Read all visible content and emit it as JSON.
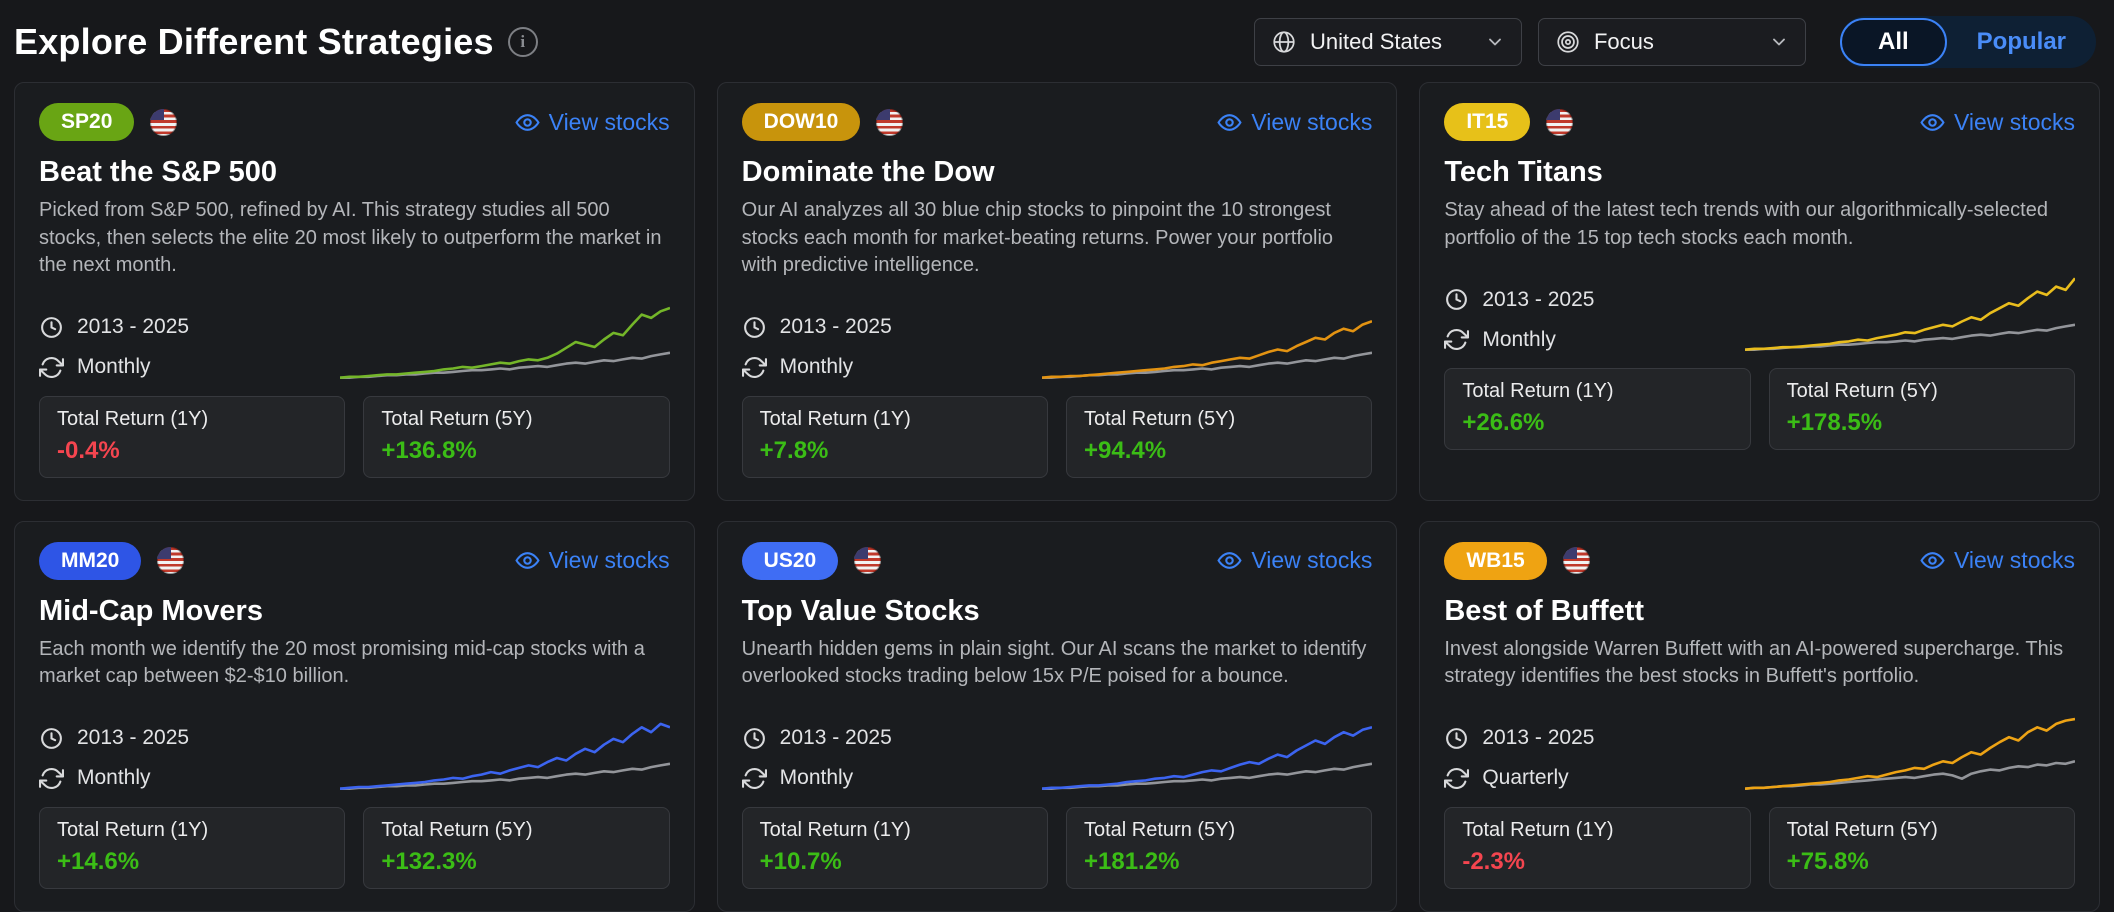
{
  "header": {
    "title": "Explore Different Strategies",
    "info_icon": "info-circle",
    "country_select": {
      "icon": "globe",
      "value": "United States"
    },
    "focus_select": {
      "icon": "target",
      "value": "Focus"
    },
    "filter_toggle": {
      "options": [
        "All",
        "Popular"
      ],
      "selected": "All"
    }
  },
  "colors": {
    "accent_blue": "#3b82f6",
    "positive_green": "#3bbd16",
    "negative_red": "#f4454f",
    "benchmark_gray": "#93959a"
  },
  "cards": [
    {
      "badge": "SP20",
      "badge_color": "#69a514",
      "flag": "united-states",
      "view_link": "View stocks",
      "title": "Beat the S&P 500",
      "description": "Picked from S&P 500, refined by AI. This strategy studies all 500 stocks, then selects the elite 20 most likely to outperform the market in the next month.",
      "period": "2013 - 2025",
      "frequency": "Monthly",
      "stats": [
        {
          "label": "Total Return (1Y)",
          "value": "-0.4%",
          "color": "#f4454f"
        },
        {
          "label": "Total Return (5Y)",
          "value": "+136.8%",
          "color": "#3bbd16"
        }
      ],
      "chart": {
        "type": "line",
        "line_color": "#74b629",
        "benchmark_color": "#93959a",
        "strategy": [
          4,
          5,
          5,
          6,
          7,
          8,
          8,
          9,
          10,
          11,
          12,
          14,
          15,
          17,
          16,
          18,
          20,
          22,
          21,
          24,
          26,
          25,
          28,
          33,
          40,
          47,
          44,
          41,
          50,
          58,
          55,
          68,
          80,
          76,
          84,
          88
        ],
        "benchmark": [
          4,
          4,
          5,
          5,
          6,
          7,
          7,
          8,
          8,
          9,
          10,
          10,
          11,
          12,
          13,
          13,
          14,
          15,
          14,
          16,
          17,
          18,
          17,
          19,
          21,
          22,
          21,
          23,
          25,
          24,
          26,
          28,
          27,
          30,
          32,
          34
        ]
      }
    },
    {
      "badge": "DOW10",
      "badge_color": "#c8940c",
      "flag": "united-states",
      "view_link": "View stocks",
      "title": "Dominate the Dow",
      "description": "Our AI analyzes all 30 blue chip stocks to pinpoint the 10 strongest stocks each month for market-beating returns. Power your portfolio with predictive intelligence.",
      "period": "2013 - 2025",
      "frequency": "Monthly",
      "stats": [
        {
          "label": "Total Return (1Y)",
          "value": "+7.8%",
          "color": "#3bbd16"
        },
        {
          "label": "Total Return (5Y)",
          "value": "+94.4%",
          "color": "#3bbd16"
        }
      ],
      "chart": {
        "type": "line",
        "line_color": "#e39312",
        "benchmark_color": "#93959a",
        "strategy": [
          4,
          5,
          5,
          6,
          6,
          7,
          8,
          9,
          10,
          11,
          12,
          13,
          14,
          15,
          17,
          18,
          20,
          19,
          22,
          24,
          26,
          28,
          27,
          31,
          35,
          38,
          36,
          42,
          47,
          52,
          50,
          58,
          63,
          60,
          68,
          72
        ],
        "benchmark": [
          4,
          4,
          5,
          5,
          6,
          7,
          7,
          8,
          8,
          9,
          10,
          10,
          11,
          12,
          13,
          13,
          14,
          15,
          14,
          16,
          17,
          18,
          17,
          19,
          21,
          22,
          21,
          23,
          25,
          24,
          26,
          28,
          27,
          30,
          32,
          34
        ]
      }
    },
    {
      "badge": "IT15",
      "badge_color": "#e7c119",
      "flag": "united-states",
      "view_link": "View stocks",
      "title": "Tech Titans",
      "description": "Stay ahead of the latest tech trends with our algorithmically-selected portfolio of the 15 top tech stocks each month.",
      "period": "2013 - 2025",
      "frequency": "Monthly",
      "stats": [
        {
          "label": "Total Return (1Y)",
          "value": "+26.6%",
          "color": "#3bbd16"
        },
        {
          "label": "Total Return (5Y)",
          "value": "+178.5%",
          "color": "#3bbd16"
        }
      ],
      "chart": {
        "type": "line",
        "line_color": "#e9bd1d",
        "benchmark_color": "#93959a",
        "strategy": [
          4,
          5,
          5,
          6,
          7,
          7,
          8,
          9,
          10,
          11,
          13,
          14,
          16,
          15,
          18,
          20,
          22,
          25,
          24,
          28,
          31,
          34,
          32,
          38,
          43,
          40,
          48,
          54,
          60,
          57,
          66,
          74,
          70,
          80,
          76,
          90
        ],
        "benchmark": [
          4,
          4,
          5,
          5,
          6,
          7,
          7,
          8,
          8,
          9,
          10,
          10,
          11,
          12,
          13,
          13,
          14,
          15,
          14,
          16,
          17,
          18,
          17,
          19,
          21,
          22,
          21,
          23,
          25,
          24,
          26,
          28,
          27,
          30,
          32,
          34
        ]
      }
    },
    {
      "badge": "MM20",
      "badge_color": "#2e55e6",
      "flag": "united-states",
      "view_link": "View stocks",
      "title": "Mid-Cap Movers",
      "description": "Each month we identify the 20 most promising mid-cap stocks with a market cap between $2-$10 billion.",
      "period": "2013 - 2025",
      "frequency": "Monthly",
      "stats": [
        {
          "label": "Total Return (1Y)",
          "value": "+14.6%",
          "color": "#3bbd16"
        },
        {
          "label": "Total Return (5Y)",
          "value": "+132.3%",
          "color": "#3bbd16"
        }
      ],
      "chart": {
        "type": "line",
        "line_color": "#3c64f0",
        "benchmark_color": "#93959a",
        "strategy": [
          4,
          5,
          6,
          6,
          7,
          8,
          9,
          10,
          11,
          12,
          14,
          15,
          17,
          16,
          19,
          21,
          24,
          22,
          26,
          29,
          32,
          30,
          36,
          41,
          38,
          46,
          52,
          48,
          57,
          64,
          60,
          70,
          78,
          72,
          82,
          78
        ],
        "benchmark": [
          4,
          4,
          5,
          5,
          6,
          7,
          7,
          8,
          8,
          9,
          10,
          10,
          11,
          12,
          13,
          13,
          14,
          15,
          14,
          16,
          17,
          18,
          17,
          19,
          21,
          22,
          21,
          23,
          25,
          24,
          26,
          28,
          27,
          30,
          32,
          34
        ]
      }
    },
    {
      "badge": "US20",
      "badge_color": "#3f6df4",
      "flag": "united-states",
      "view_link": "View stocks",
      "title": "Top Value Stocks",
      "description": "Unearth hidden gems in plain sight. Our AI scans the market to identify overlooked stocks trading below 15x P/E poised for a bounce.",
      "period": "2013 - 2025",
      "frequency": "Monthly",
      "stats": [
        {
          "label": "Total Return (1Y)",
          "value": "+10.7%",
          "color": "#3bbd16"
        },
        {
          "label": "Total Return (5Y)",
          "value": "+181.2%",
          "color": "#3bbd16"
        }
      ],
      "chart": {
        "type": "line",
        "line_color": "#3c64f0",
        "benchmark_color": "#93959a",
        "strategy": [
          4,
          5,
          5,
          6,
          7,
          8,
          8,
          9,
          10,
          12,
          13,
          14,
          16,
          17,
          19,
          18,
          21,
          24,
          26,
          25,
          29,
          33,
          36,
          34,
          40,
          45,
          42,
          50,
          56,
          62,
          58,
          66,
          72,
          68,
          75,
          78
        ],
        "benchmark": [
          4,
          4,
          5,
          5,
          6,
          7,
          7,
          8,
          8,
          9,
          10,
          10,
          11,
          12,
          13,
          13,
          14,
          15,
          14,
          16,
          17,
          18,
          17,
          19,
          21,
          22,
          21,
          23,
          25,
          24,
          26,
          28,
          27,
          30,
          32,
          34
        ]
      }
    },
    {
      "badge": "WB15",
      "badge_color": "#efa312",
      "flag": "united-states",
      "view_link": "View stocks",
      "title": "Best of Buffett",
      "description": "Invest alongside Warren Buffett with an AI-powered supercharge. This strategy identifies the best stocks in Buffett's portfolio.",
      "period": "2013 - 2025",
      "frequency": "Quarterly",
      "stats": [
        {
          "label": "Total Return (1Y)",
          "value": "-2.3%",
          "color": "#f4454f"
        },
        {
          "label": "Total Return (5Y)",
          "value": "+75.8%",
          "color": "#3bbd16"
        }
      ],
      "chart": {
        "type": "line",
        "line_color": "#eda315",
        "benchmark_color": "#93959a",
        "strategy": [
          4,
          5,
          5,
          6,
          7,
          8,
          9,
          10,
          11,
          12,
          14,
          15,
          17,
          19,
          18,
          21,
          24,
          26,
          29,
          28,
          33,
          37,
          35,
          42,
          48,
          45,
          53,
          60,
          66,
          62,
          72,
          78,
          74,
          82,
          86,
          88
        ],
        "benchmark": [
          4,
          5,
          5,
          6,
          7,
          7,
          8,
          9,
          9,
          10,
          11,
          12,
          13,
          14,
          15,
          16,
          17,
          18,
          17,
          19,
          21,
          22,
          20,
          16,
          22,
          25,
          27,
          26,
          29,
          31,
          30,
          33,
          32,
          35,
          34,
          37
        ]
      }
    }
  ]
}
